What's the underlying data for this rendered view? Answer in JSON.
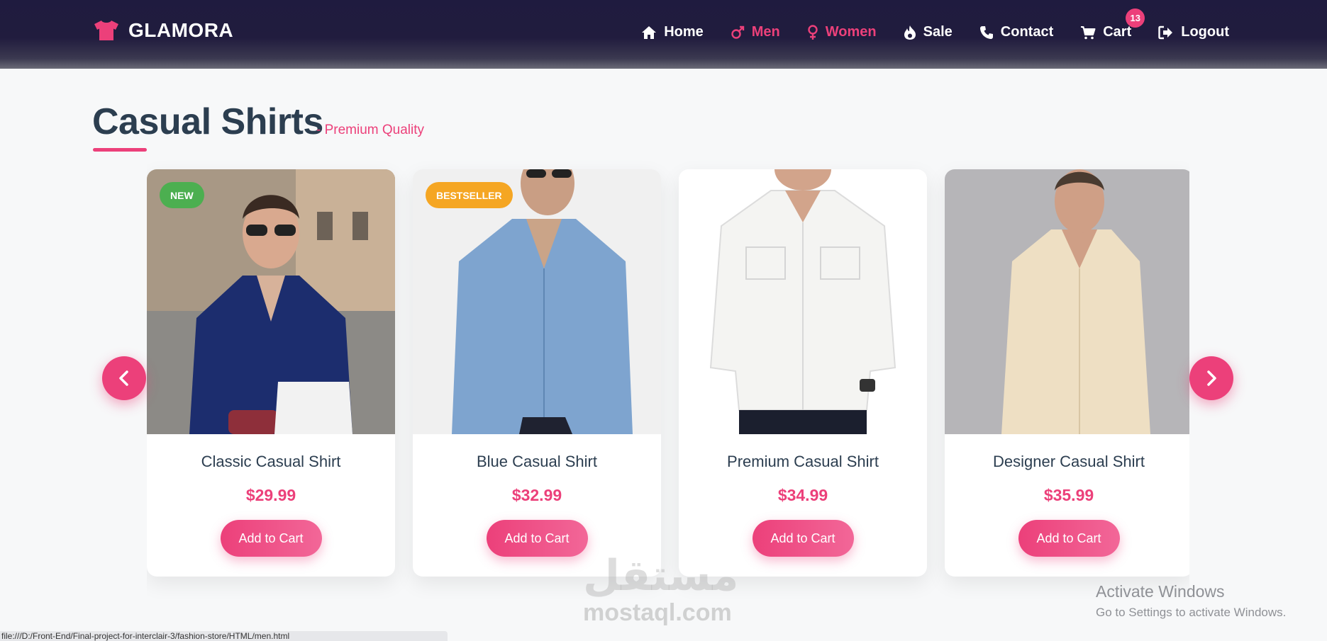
{
  "brand": {
    "name": "GLAMORA",
    "icon": "tshirt-icon",
    "color": "#ec407a"
  },
  "nav": [
    {
      "label": "Home",
      "icon": "home-icon",
      "active": false
    },
    {
      "label": "Men",
      "icon": "male-icon",
      "active": true
    },
    {
      "label": "Women",
      "icon": "female-icon",
      "active": true
    },
    {
      "label": "Sale",
      "icon": "fire-icon",
      "active": false
    },
    {
      "label": "Contact",
      "icon": "phone-icon",
      "active": false
    },
    {
      "label": "Cart",
      "icon": "cart-icon",
      "active": false,
      "badge": "13"
    },
    {
      "label": "Logout",
      "icon": "logout-icon",
      "active": false
    }
  ],
  "section": {
    "title": "Casual Shirts",
    "subtitle": "- Premium Quality"
  },
  "products": [
    {
      "name": "Classic Casual Shirt",
      "price": "$29.99",
      "badge": "NEW",
      "button": "Add to Cart",
      "shirt_color": "#1c2d6e"
    },
    {
      "name": "Blue Casual Shirt",
      "price": "$32.99",
      "badge": "BESTSELLER",
      "button": "Add to Cart",
      "shirt_color": "#7ea4cf"
    },
    {
      "name": "Premium Casual Shirt",
      "price": "$34.99",
      "badge": "",
      "button": "Add to Cart",
      "shirt_color": "#f4f4f2"
    },
    {
      "name": "Designer Casual Shirt",
      "price": "$35.99",
      "badge": "",
      "button": "Add to Cart",
      "shirt_color": "#eedfc3"
    }
  ],
  "carousel": {
    "prev_icon": "chevron-left-icon",
    "next_icon": "chevron-right-icon"
  },
  "watermark": {
    "arabic": "مستقل",
    "latin": "mostaql.com"
  },
  "windows": {
    "line1": "Activate Windows",
    "line2": "Go to Settings to activate Windows."
  },
  "status_bar": "file:///D:/Front-End/Final-project-for-interclair-3/fashion-store/HTML/men.html",
  "colors": {
    "accent": "#ec407a",
    "nav_bg": "#1f1b3f",
    "heading": "#2c3e50",
    "badge_new": "#4caf50",
    "badge_best": "#f5a623"
  }
}
